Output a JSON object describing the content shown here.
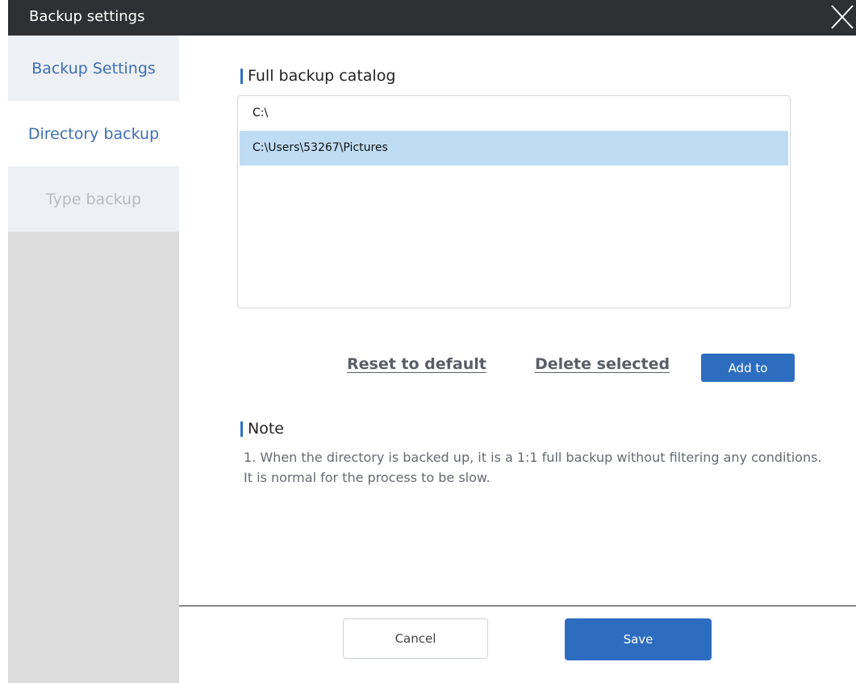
{
  "window": {
    "title": "Backup settings",
    "close_icon": "close-icon"
  },
  "sidebar": {
    "items": [
      {
        "label": "Backup Settings",
        "state": "normal"
      },
      {
        "label": "Directory backup",
        "state": "active"
      },
      {
        "label": "Type backup",
        "state": "disabled"
      }
    ]
  },
  "catalog": {
    "heading": "Full backup catalog",
    "entries": [
      {
        "path": "C:\\",
        "selected": false
      },
      {
        "path": "C:\\Users\\53267\\Pictures",
        "selected": true
      }
    ]
  },
  "actions": {
    "reset_label": "Reset to default",
    "delete_label": "Delete selected",
    "add_label": "Add to"
  },
  "note": {
    "heading": "Note",
    "text": "1. When the directory is backed up, it is a 1:1 full backup without filtering any conditions. It is normal for the process to be slow."
  },
  "footer": {
    "cancel_label": "Cancel",
    "save_label": "Save"
  },
  "colors": {
    "accent": "#2d6dc0",
    "title_bar": "#2f3033",
    "sidebar_text_active": "#3e6fb3",
    "selected_row": "#bfdcf5"
  }
}
